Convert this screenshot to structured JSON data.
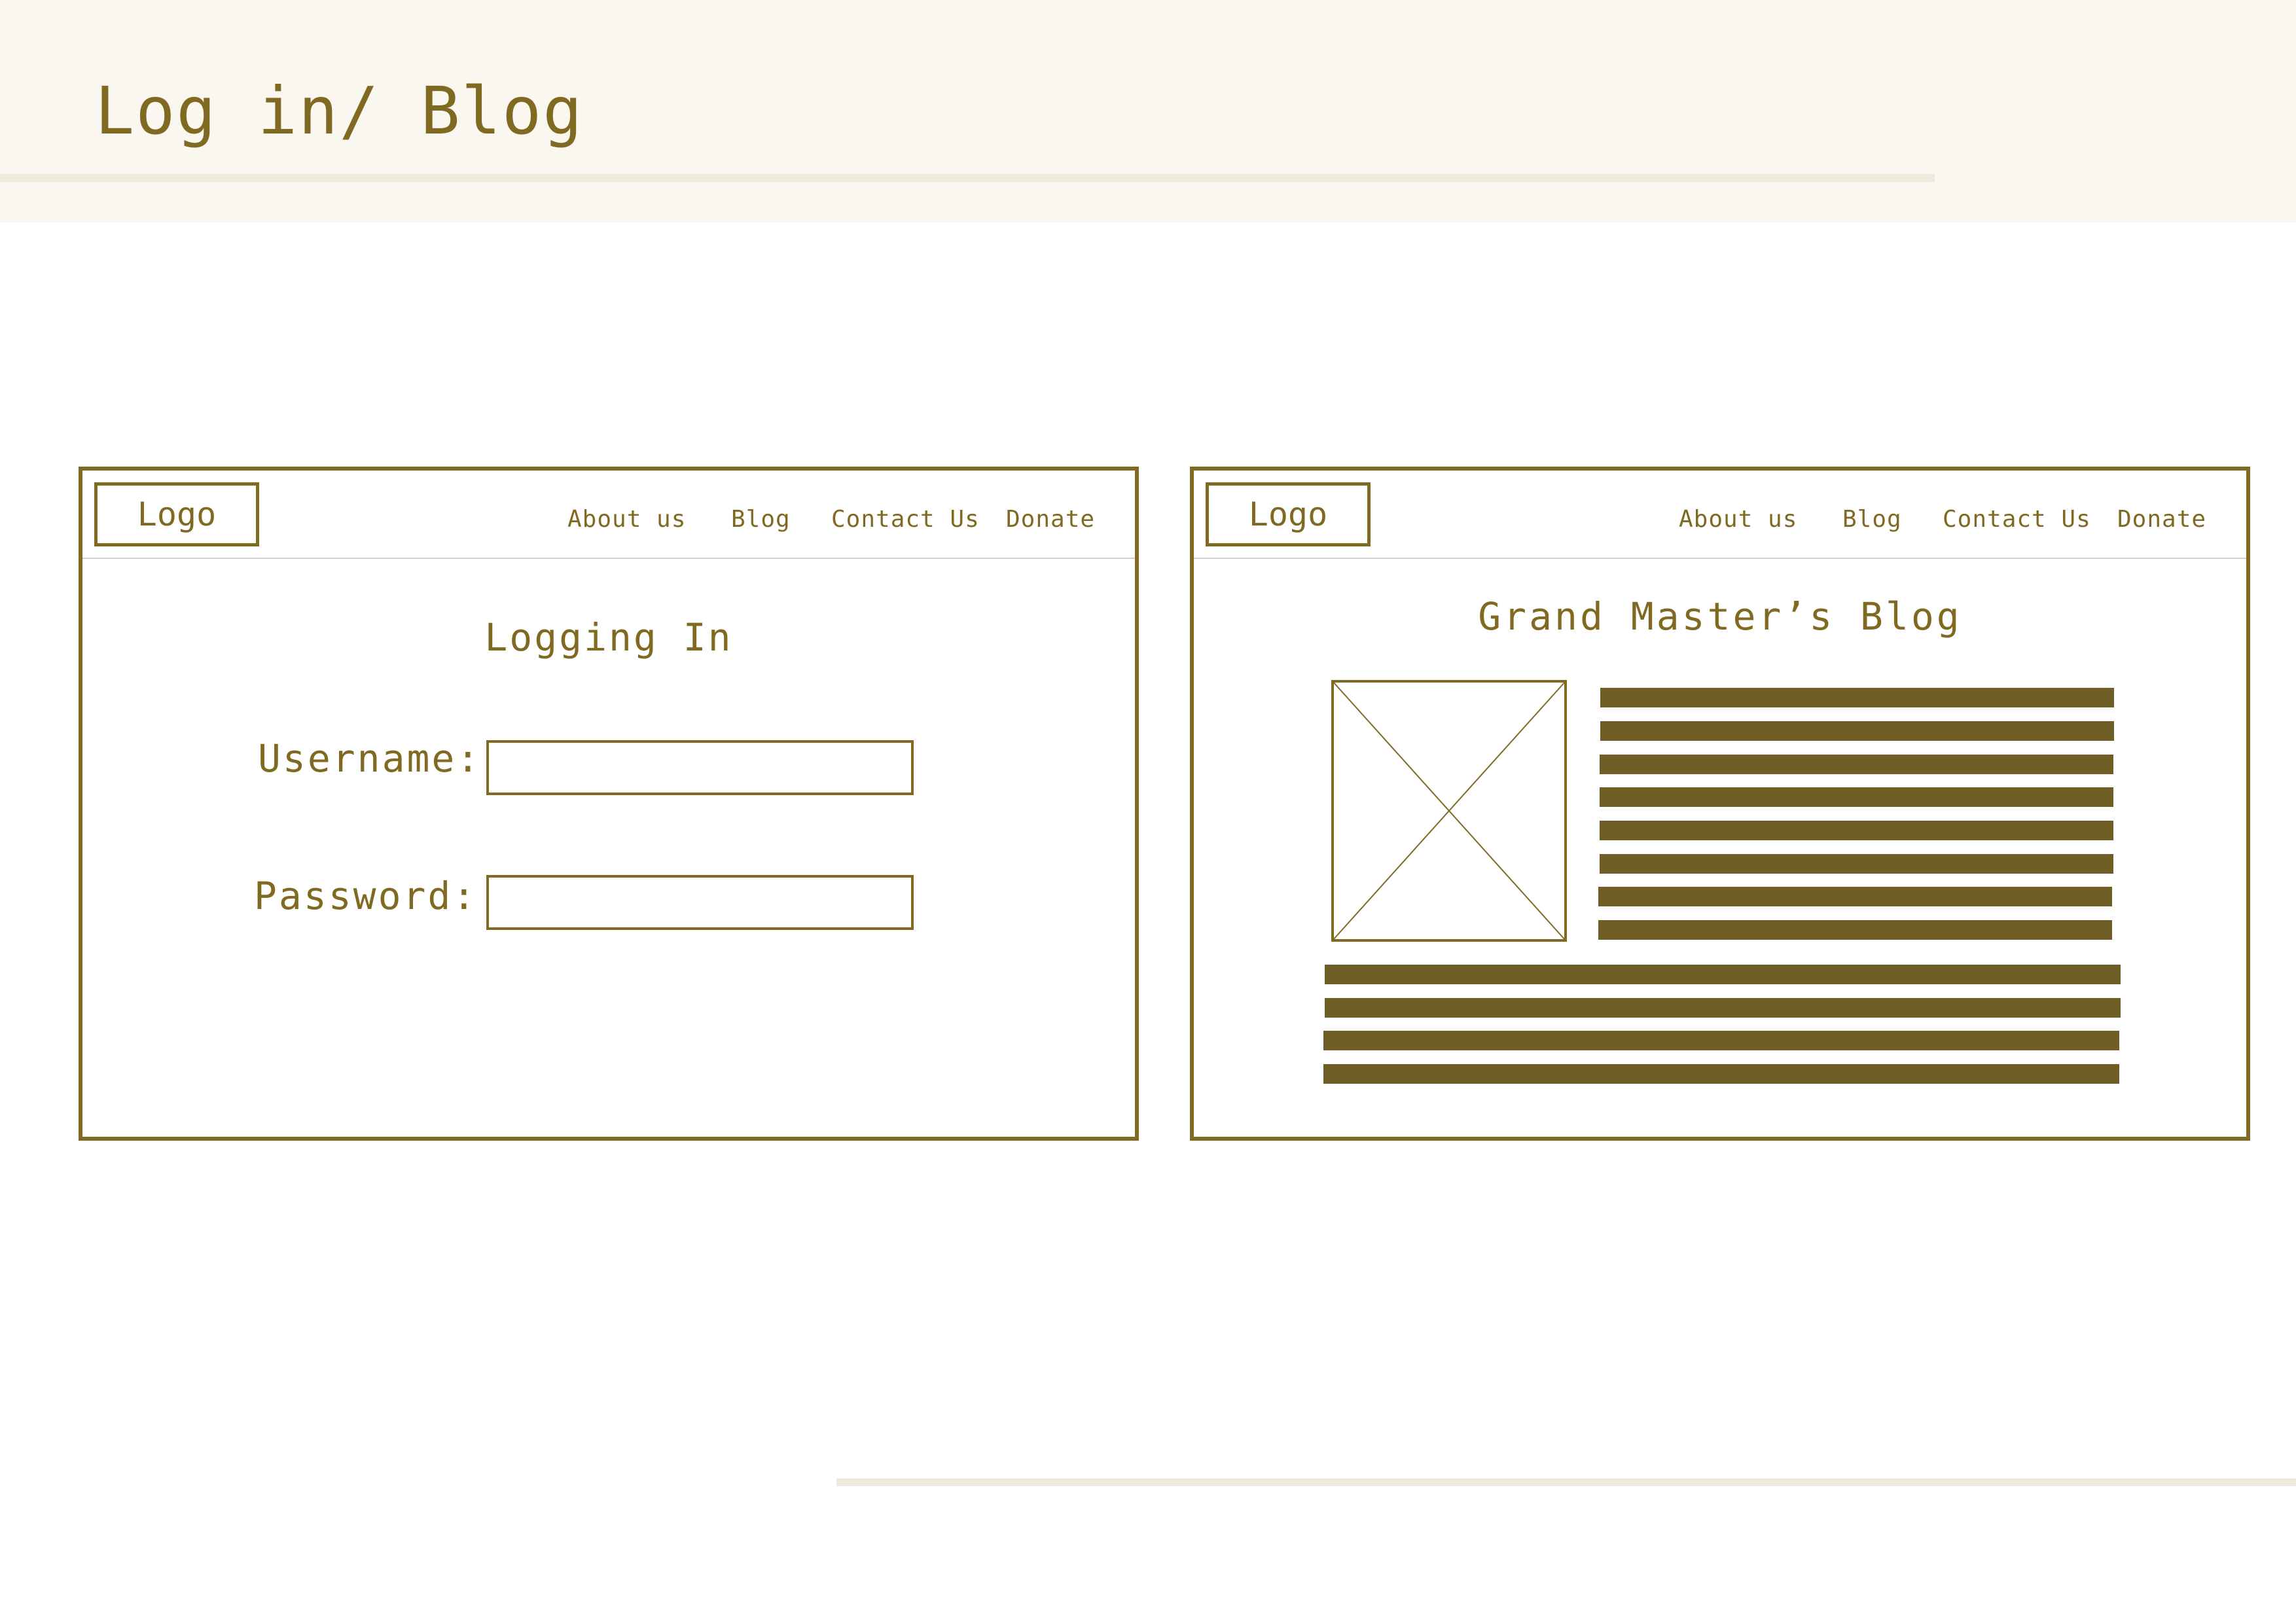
{
  "page": {
    "title": "Log in/ Blog"
  },
  "colors": {
    "accent": "#806a22",
    "text_bar": "#6f5f27",
    "header_background": "#faf7f0",
    "rule": "#efeadb"
  },
  "login_frame": {
    "logo": "Logo",
    "nav": {
      "about": "About us",
      "blog": "Blog",
      "contact": "Contact Us",
      "donate": "Donate"
    },
    "heading": "Logging In",
    "username_label": "Username:",
    "password_label": "Password:",
    "username_value": "",
    "password_value": ""
  },
  "blog_frame": {
    "logo": "Logo",
    "nav": {
      "about": "About us",
      "blog": "Blog",
      "contact": "Contact Us",
      "donate": "Donate"
    },
    "heading": "Grand Master’s Blog",
    "image_placeholder_icon": "image-placeholder-icon",
    "text_line_placeholder_count": 12
  }
}
